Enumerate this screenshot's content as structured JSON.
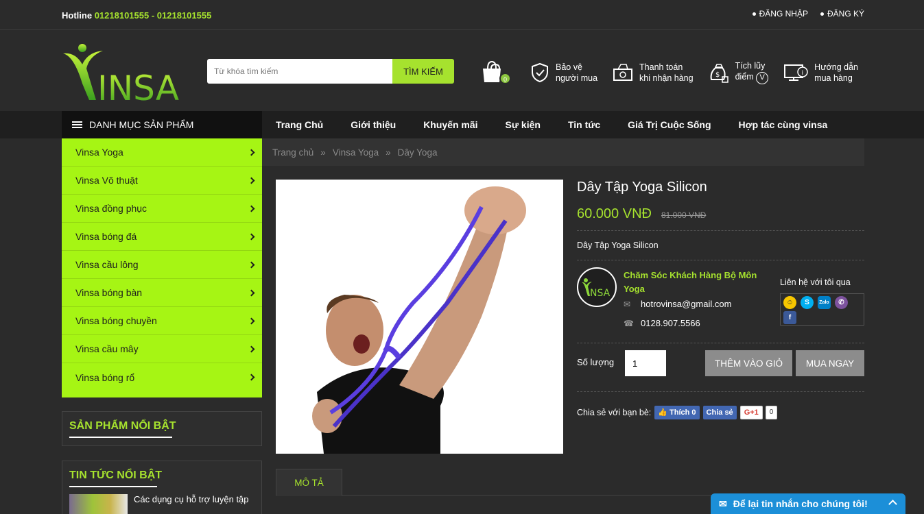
{
  "topbar": {
    "hotline_label": "Hotline",
    "hotline_numbers": "01218101555 - 01218101555",
    "login": "ĐĂNG NHẬP",
    "register": "ĐĂNG KÝ"
  },
  "header": {
    "logo_text": "VINSA",
    "search_placeholder": "Từ khóa tìm kiếm",
    "search_button": "TÌM KIẾM",
    "cart_count": "0",
    "features": [
      {
        "icon": "shield-check-icon",
        "line1": "Bảo vệ",
        "line2": "người mua"
      },
      {
        "icon": "cash-icon",
        "line1": "Thanh toán",
        "line2": "khi nhận hàng"
      },
      {
        "icon": "money-bag-icon",
        "line1": "Tích lũy",
        "line2": "điểm"
      },
      {
        "icon": "guide-screen-icon",
        "line1": "Hướng dẫn",
        "line2": "mua hàng"
      }
    ]
  },
  "nav": {
    "category_menu": "DANH MỤC SẢN PHẨM",
    "links": [
      "Trang Chủ",
      "Giới thiệu",
      "Khuyến mãi",
      "Sự kiện",
      "Tin tức",
      "Giá Trị Cuộc Sống",
      "Hợp tác cùng vinsa"
    ]
  },
  "sidebar": {
    "categories": [
      "Vinsa Yoga",
      "Vinsa Võ thuật",
      "Vinsa đồng phục",
      "Vinsa bóng đá",
      "Vinsa cầu lông",
      "Vinsa bóng bàn",
      "Vinsa bóng chuyền",
      "Vinsa cầu mây",
      "Vinsa bóng rổ"
    ],
    "featured_title": "SẢN PHẨM NỔI BẬT",
    "news_title": "TIN TỨC NỔI BẬT",
    "news_item": "Các dụng cụ hỗ trợ luyện tập"
  },
  "breadcrumb": {
    "items": [
      "Trang chủ",
      "Vinsa Yoga",
      "Dây Yoga"
    ],
    "separator": "»"
  },
  "product": {
    "title": "Dây Tập Yoga Silicon",
    "price": "60.000 VNĐ",
    "old_price": "81.000 VNĐ",
    "short_desc": "Dây Tập Yoga Silicon",
    "seller_name": "Chăm Sóc Khách Hàng Bộ Môn Yoga",
    "seller_email": "hotrovinsa@gmail.com",
    "seller_phone": "0128.907.5566",
    "contact_label": "Liên hệ với tôi qua",
    "qty_label": "Số lượng",
    "qty_value": "1",
    "add_to_cart": "THÊM VÀO GIỎ",
    "buy_now": "MUA NGAY",
    "share_label": "Chia sẻ với bạn bè:",
    "fb_like": "Thích 0",
    "fb_share": "Chia sẻ",
    "gplus": "G+1",
    "gplus_count": "0"
  },
  "tabs": {
    "description": "MÔ TẢ"
  },
  "chat": {
    "label": "Để lại tin nhắn cho chúng tôi!"
  },
  "colors": {
    "accent": "#a6e22e",
    "sidebar_bg": "#a6f514",
    "page_bg": "#2b2b2b",
    "chat_bg": "#1c8fd8"
  }
}
